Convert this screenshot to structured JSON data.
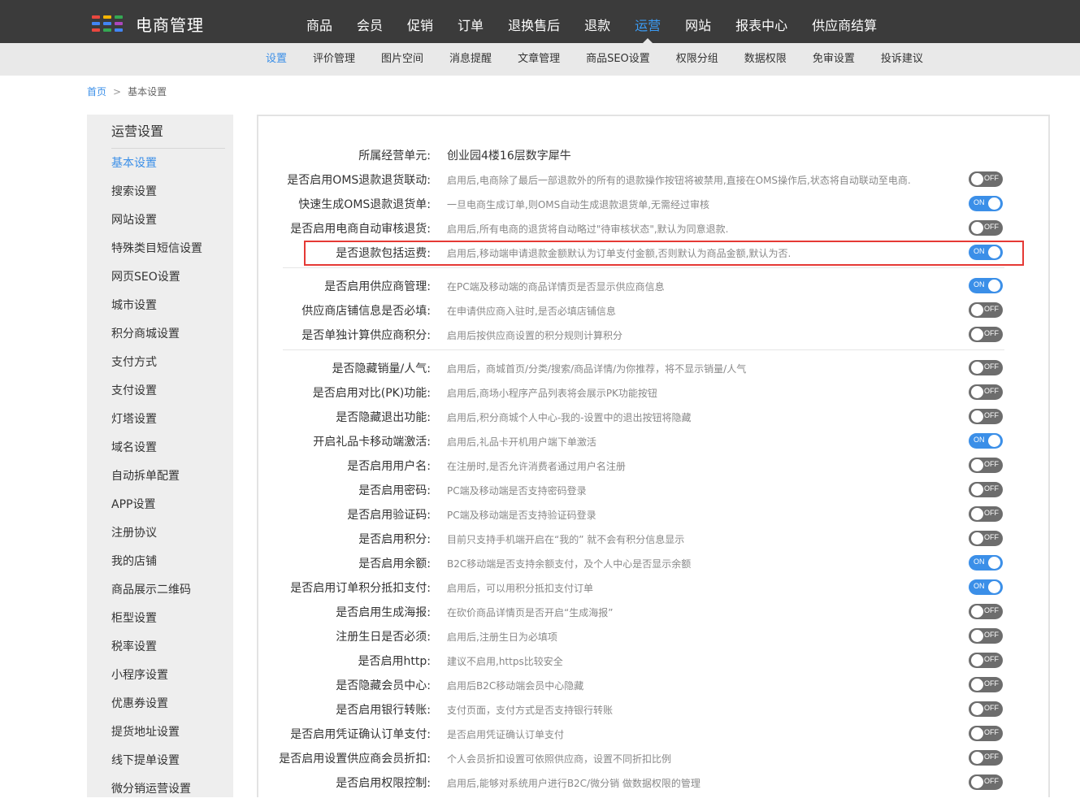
{
  "brand": {
    "title": "电商管理",
    "logo_colors": [
      "#e9473f",
      "#f4b400",
      "#34a853",
      "#4285f4",
      "#4285f4",
      "#ab47bc",
      "#e9473f",
      "#34a853",
      "#4285f4"
    ]
  },
  "main_nav": {
    "items": [
      "商品",
      "会员",
      "促销",
      "订单",
      "退换售后",
      "退款",
      "运营",
      "网站",
      "报表中心",
      "供应商结算"
    ],
    "active_index": 6
  },
  "sub_nav": {
    "items": [
      "设置",
      "评价管理",
      "图片空间",
      "消息提醒",
      "文章管理",
      "商品SEO设置",
      "权限分组",
      "数据权限",
      "免审设置",
      "投诉建议"
    ],
    "active_index": 0
  },
  "breadcrumb": {
    "home": "首页",
    "separator": ">",
    "current": "基本设置"
  },
  "sidebar": {
    "title": "运营设置",
    "active_index": 0,
    "items": [
      "基本设置",
      "搜索设置",
      "网站设置",
      "特殊类目短信设置",
      "网页SEO设置",
      "城市设置",
      "积分商城设置",
      "支付方式",
      "支付设置",
      "灯塔设置",
      "域名设置",
      "自动拆单配置",
      "APP设置",
      "注册协议",
      "我的店铺",
      "商品展示二维码",
      "柜型设置",
      "税率设置",
      "小程序设置",
      "优惠券设置",
      "提货地址设置",
      "线下提单设置",
      "微分销运营设置"
    ]
  },
  "settings": {
    "business_unit": {
      "label": "所属经营单元:",
      "value": "创业园4楼16层数字犀牛"
    },
    "toggle_on_text": "ON",
    "toggle_off_text": "OFF",
    "rows": [
      {
        "label": "是否启用OMS退款退货联动:",
        "desc": "启用后,电商除了最后一部退款外的所有的退款操作按钮将被禁用,直接在OMS操作后,状态将自动联动至电商.",
        "on": false
      },
      {
        "label": "快速生成OMS退款退货单:",
        "desc": "一旦电商生成订单,则OMS自动生成退款退货单,无需经过审核",
        "on": true
      },
      {
        "label": "是否启用电商自动审核退货:",
        "desc": "启用后,所有电商的退货将自动略过\"待审核状态\",默认为同意退款.",
        "on": false
      },
      {
        "label": "是否退款包括运费:",
        "desc": "启用后,移动端申请退款金额默认为订单支付金额,否则默认为商品金额,默认为否.",
        "on": true
      },
      {
        "label": "是否启用供应商管理:",
        "desc": "在PC端及移动端的商品详情页是否显示供应商信息",
        "on": true
      },
      {
        "label": "供应商店铺信息是否必填:",
        "desc": "在申请供应商入驻时,是否必填店铺信息",
        "on": false
      },
      {
        "label": "是否单独计算供应商积分:",
        "desc": "启用后按供应商设置的积分规则计算积分",
        "on": false
      },
      {
        "label": "是否隐藏销量/人气:",
        "desc": "启用后，商城首页/分类/搜索/商品详情/为你推荐，将不显示销量/人气",
        "on": false
      },
      {
        "label": "是否启用对比(PK)功能:",
        "desc": "启用后,商场小程序产品列表将会展示PK功能按钮",
        "on": false
      },
      {
        "label": "是否隐藏退出功能:",
        "desc": "启用后,积分商城个人中心-我的-设置中的退出按钮将隐藏",
        "on": false
      },
      {
        "label": "开启礼品卡移动端激活:",
        "desc": "启用后,礼品卡开机用户端下单激活",
        "on": true
      },
      {
        "label": "是否启用用户名:",
        "desc": "在注册时,是否允许消费者通过用户名注册",
        "on": false
      },
      {
        "label": "是否启用密码:",
        "desc": "PC端及移动端是否支持密码登录",
        "on": false
      },
      {
        "label": "是否启用验证码:",
        "desc": "PC端及移动端是否支持验证码登录",
        "on": false
      },
      {
        "label": "是否启用积分:",
        "desc": "目前只支持手机端开启在“我的” 就不会有积分信息显示",
        "on": false
      },
      {
        "label": "是否启用余额:",
        "desc": "B2C移动端是否支持余额支付，及个人中心是否显示余额",
        "on": true
      },
      {
        "label": "是否启用订单积分抵扣支付:",
        "desc": "启用后，可以用积分抵扣支付订单",
        "on": true
      },
      {
        "label": "是否启用生成海报:",
        "desc": "在砍价商品详情页是否开启“生成海报”",
        "on": false
      },
      {
        "label": "注册生日是否必须:",
        "desc": "启用后,注册生日为必填项",
        "on": false
      },
      {
        "label": "是否启用http:",
        "desc": "建议不启用,https比较安全",
        "on": false
      },
      {
        "label": "是否隐藏会员中心:",
        "desc": "启用后B2C移动端会员中心隐藏",
        "on": false
      },
      {
        "label": "是否启用银行转账:",
        "desc": "支付页面，支付方式是否支持银行转账",
        "on": false
      },
      {
        "label": "是否启用凭证确认订单支付:",
        "desc": "是否启用凭证确认订单支付",
        "on": false
      },
      {
        "label": "是否启用设置供应商会员折扣:",
        "desc": "个人会员折扣设置可依照供应商，设置不同折扣比例",
        "on": false
      },
      {
        "label": "是否启用权限控制:",
        "desc": "启用后,能够对系统用户进行B2C/微分销 做数据权限的管理",
        "on": false
      }
    ]
  }
}
